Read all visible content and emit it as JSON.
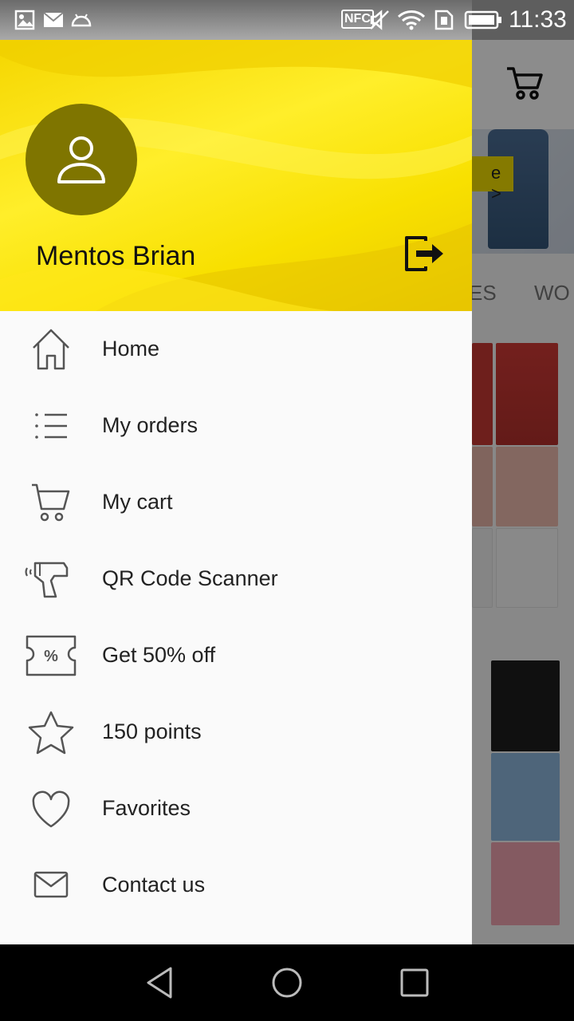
{
  "status_bar": {
    "time": "11:33",
    "nfc_label": "NFC",
    "icons": [
      "gallery-icon",
      "mail-icon",
      "android-icon",
      "nfc-icon",
      "mute-icon",
      "wifi-icon",
      "sim-icon",
      "battery-icon"
    ]
  },
  "background_app": {
    "categories": [
      "ES",
      "WO"
    ],
    "banner_arrow": "e >"
  },
  "drawer": {
    "user_name": "Mentos Brian",
    "header_color": "#f5d600",
    "avatar_color": "#7f7500",
    "items": [
      {
        "label": "Home",
        "icon": "home-icon"
      },
      {
        "label": "My orders",
        "icon": "list-icon"
      },
      {
        "label": "My cart",
        "icon": "cart-icon"
      },
      {
        "label": "QR Code Scanner",
        "icon": "scanner-icon"
      },
      {
        "label": "Get 50% off",
        "icon": "coupon-icon"
      },
      {
        "label": "150 points",
        "icon": "star-icon"
      },
      {
        "label": "Favorites",
        "icon": "heart-icon"
      },
      {
        "label": "Contact us",
        "icon": "mail-icon"
      }
    ]
  },
  "nav_bar": {
    "buttons": [
      "back-icon",
      "home-circle-icon",
      "recents-icon"
    ]
  }
}
